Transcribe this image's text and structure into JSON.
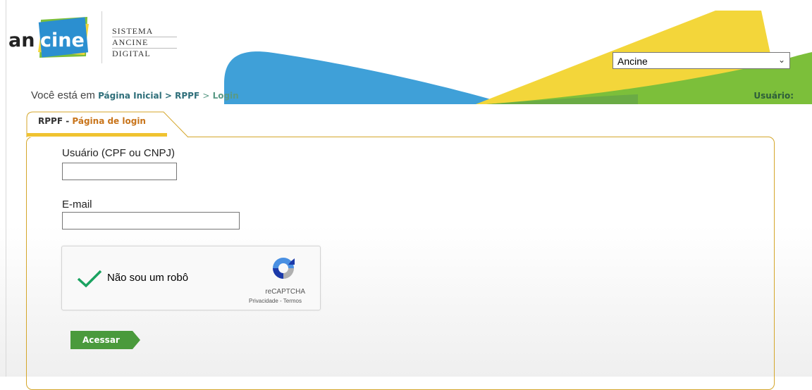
{
  "header": {
    "logo_text": "ancine",
    "system_title": [
      "SISTEMA",
      "ANCINE",
      "DIGITAL"
    ],
    "org_select": {
      "selected": "Ancine"
    },
    "breadcrumb": {
      "prefix": "Você está em",
      "items": [
        "Página Inicial",
        "RPPF",
        "Login"
      ],
      "separator": ">"
    },
    "user_label": "Usuário:"
  },
  "panel": {
    "tab_prefix": "RPPF -",
    "tab_title": "Página de login"
  },
  "form": {
    "user_label": "Usuário (CPF ou CNPJ)",
    "user_value": "",
    "email_label": "E-mail",
    "email_value": "",
    "captcha": {
      "label": "Não sou um robô",
      "brand": "reCAPTCHA",
      "privacy": "Privacidade",
      "terms": "Termos",
      "checked": true
    },
    "submit_label": "Acessar"
  },
  "colors": {
    "accent_border": "#d4a62a",
    "button_green": "#4a9a3c",
    "check_green": "#1aa260",
    "link_teal": "#2f6f7a"
  }
}
